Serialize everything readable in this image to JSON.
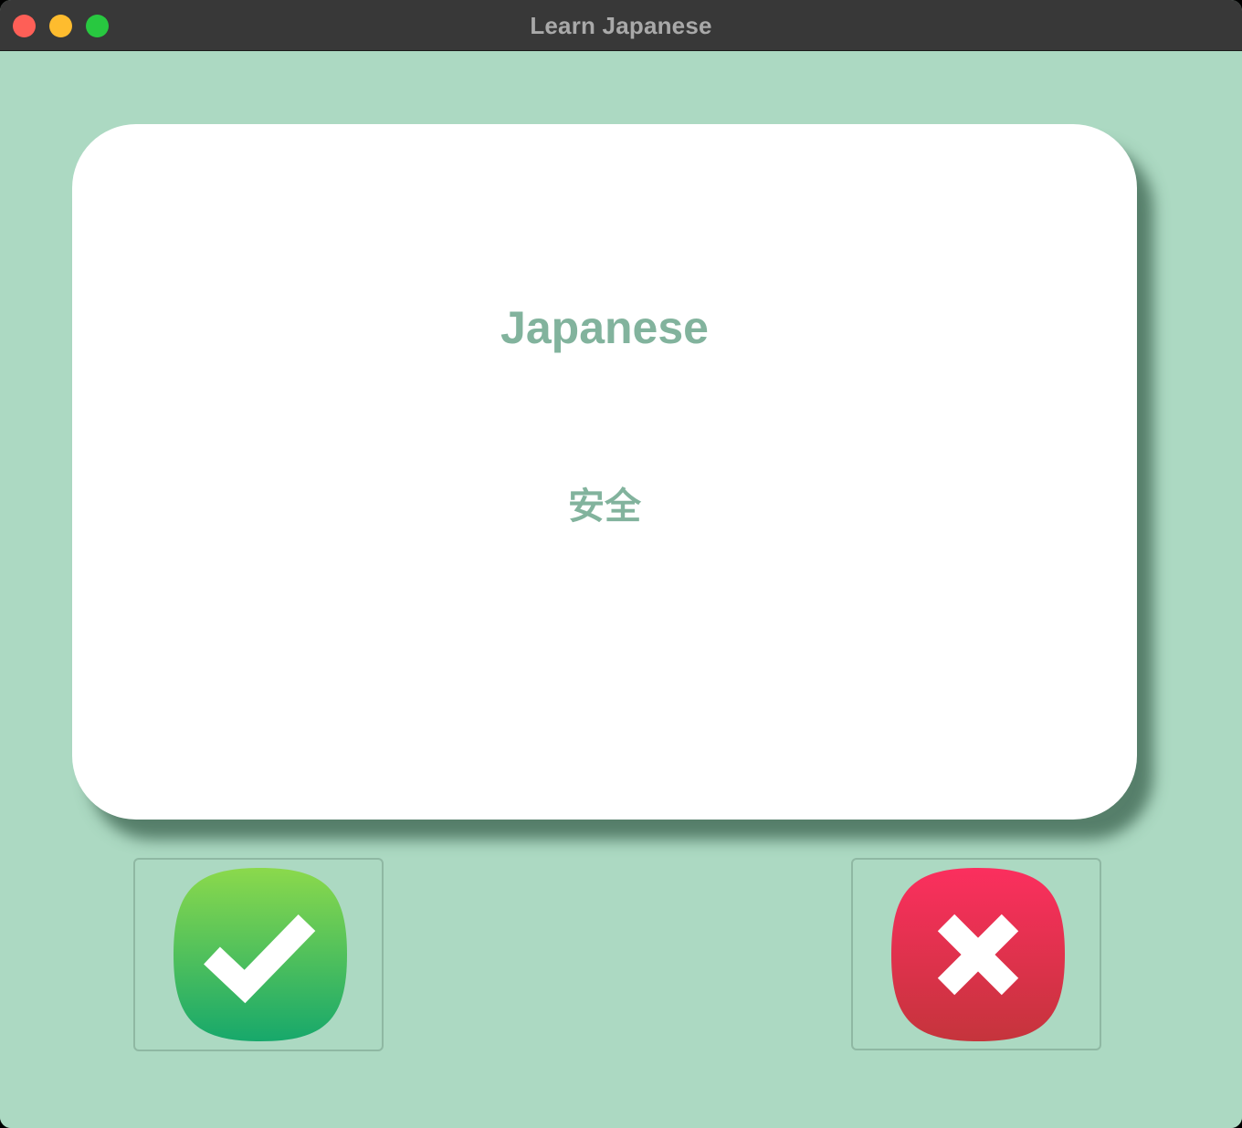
{
  "window": {
    "title": "Learn Japanese"
  },
  "card": {
    "language": "Japanese",
    "word": "安全"
  },
  "buttons": {
    "right": {
      "icon": "checkmark-icon",
      "color_top": "#8bd94c",
      "color_bottom": "#17a86b"
    },
    "wrong": {
      "icon": "cross-icon",
      "color_top": "#fb2f5e",
      "color_bottom": "#c5343c"
    }
  },
  "colors": {
    "background": "#acd9c2",
    "card": "#ffffff",
    "text": "#82b39d"
  }
}
